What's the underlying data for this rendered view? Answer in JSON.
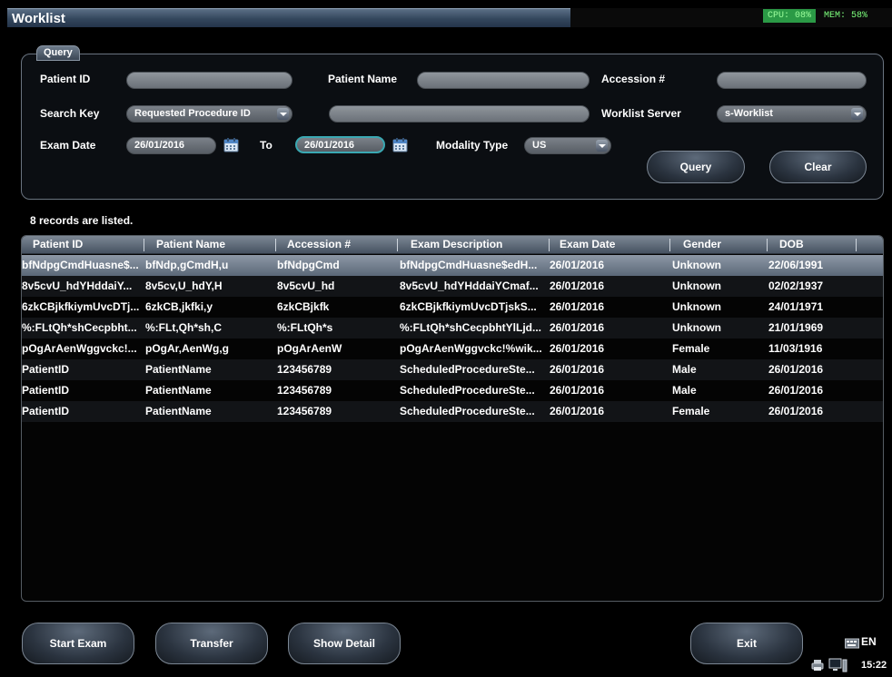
{
  "window": {
    "title": "Worklist"
  },
  "system": {
    "cpu": "CPU: 08%",
    "mem": "MEM: 58%"
  },
  "query": {
    "tab_label": "Query",
    "patient_id_label": "Patient ID",
    "patient_id_value": "",
    "patient_name_label": "Patient Name",
    "patient_name_value": "",
    "accession_label": "Accession #",
    "accession_value": "",
    "search_key_label": "Search Key",
    "search_key_value": "Requested Procedure ID",
    "search_text_value": "",
    "worklist_server_label": "Worklist Server",
    "worklist_server_value": "s-Worklist",
    "exam_date_label": "Exam Date",
    "exam_date_from": "26/01/2016",
    "to_label": "To",
    "exam_date_to": "26/01/2016",
    "modality_label": "Modality Type",
    "modality_value": "US",
    "query_button": "Query",
    "clear_button": "Clear"
  },
  "records_text": "8 records are listed.",
  "table": {
    "headers": [
      "Patient ID",
      "Patient Name",
      "Accession #",
      "Exam Description",
      "Exam Date",
      "Gender",
      "DOB"
    ],
    "rows": [
      [
        "bfNdpgCmdHuasne$...",
        "bfNdp,gCmdH,u",
        "bfNdpgCmd",
        "bfNdpgCmdHuasne$edH...",
        "26/01/2016",
        "Unknown",
        "22/06/1991"
      ],
      [
        "8v5cvU_hdYHddaiY...",
        "8v5cv,U_hdY,H",
        "8v5cvU_hd",
        "8v5cvU_hdYHddaiYCmaf...",
        "26/01/2016",
        "Unknown",
        "02/02/1937"
      ],
      [
        "6zkCBjkfkiymUvcDTj...",
        "6zkCB,jkfki,y",
        "6zkCBjkfk",
        "6zkCBjkfkiymUvcDTjskS...",
        "26/01/2016",
        "Unknown",
        "24/01/1971"
      ],
      [
        "%:FLtQh*shCecpbht...",
        "%:FLt,Qh*sh,C",
        "%:FLtQh*s",
        "%:FLtQh*shCecpbhtYlLjd...",
        "26/01/2016",
        "Unknown",
        "21/01/1969"
      ],
      [
        "pOgArAenWggvckc!...",
        "pOgAr,AenWg,g",
        "pOgArAenW",
        "pOgArAenWggvckc!%wik...",
        "26/01/2016",
        "Female",
        "11/03/1916"
      ],
      [
        "PatientID",
        "PatientName",
        "123456789",
        "ScheduledProcedureSte...",
        "26/01/2016",
        "Male",
        "26/01/2016"
      ],
      [
        "PatientID",
        "PatientName",
        "123456789",
        "ScheduledProcedureSte...",
        "26/01/2016",
        "Male",
        "26/01/2016"
      ],
      [
        "PatientID",
        "PatientName",
        "123456789",
        "ScheduledProcedureSte...",
        "26/01/2016",
        "Female",
        "26/01/2016"
      ]
    ],
    "selected_row": 0
  },
  "bottom": {
    "start_exam": "Start Exam",
    "transfer": "Transfer",
    "show_detail": "Show Detail",
    "exit": "Exit"
  },
  "tray": {
    "language": "EN",
    "time": "15:22"
  }
}
